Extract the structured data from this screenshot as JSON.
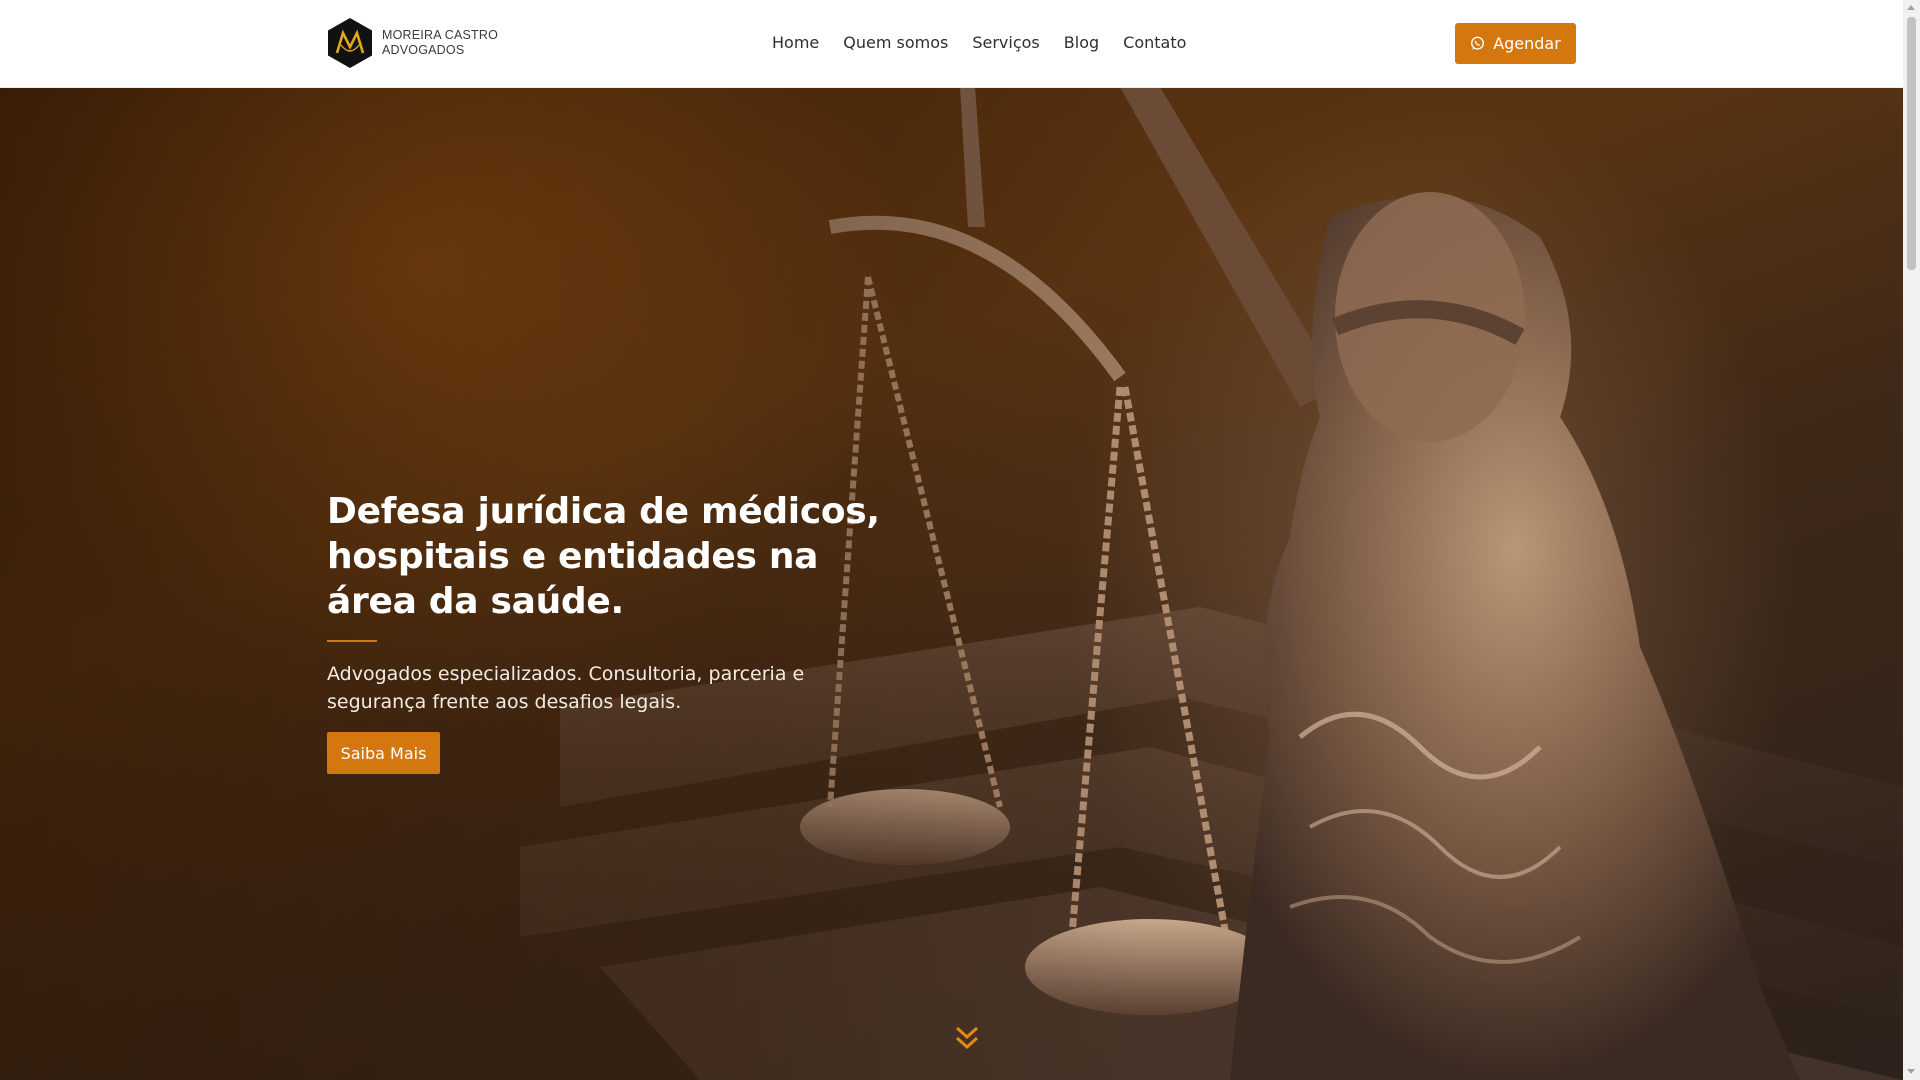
{
  "header": {
    "logo_line1": "MOREIRA CASTRO",
    "logo_line2": "ADVOGADOS",
    "logo_monogram": "M",
    "nav": [
      {
        "label": "Home"
      },
      {
        "label": "Quem somos"
      },
      {
        "label": "Serviços"
      },
      {
        "label": "Blog"
      },
      {
        "label": "Contato"
      }
    ],
    "cta_label": "Agendar",
    "cta_icon": "whatsapp-icon"
  },
  "hero": {
    "title": "Defesa jurídica de médicos, hospitais e entidades na área da saúde.",
    "subtitle": "Advogados especializados. Consultoria, parceria e segurança frente aos desafios legais.",
    "button_label": "Saiba Mais",
    "scroll_icon": "double-chevron-down-icon",
    "background_image": "lady-justice-statue-with-scales"
  },
  "colors": {
    "accent": "#d4770e",
    "header_bg": "#ffffff",
    "hero_dark": "#3e2818"
  }
}
